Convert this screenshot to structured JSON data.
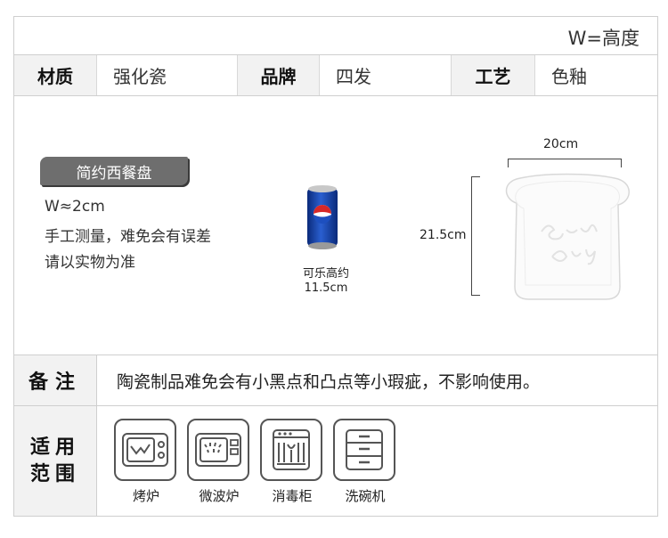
{
  "header": {
    "legend": "W=高度"
  },
  "specs": [
    {
      "key": "材质",
      "value": "强化瓷"
    },
    {
      "key": "品牌",
      "value": "四发"
    },
    {
      "key": "工艺",
      "value": "色釉"
    }
  ],
  "product": {
    "name": "简约西餐盘",
    "notes": [
      "W≈2cm",
      "手工测量，难免会有误差",
      "请以实物为准"
    ],
    "can_caption": [
      "可乐高约",
      "11.5cm"
    ],
    "width": "20cm",
    "height": "21.5cm"
  },
  "remark": {
    "label": "备注",
    "text": "陶瓷制品难免会有小黑点和凸点等小瑕疵，不影响使用。"
  },
  "usage": {
    "label_line1": "适用",
    "label_line2": "范围",
    "items": [
      {
        "icon": "oven-icon",
        "label": "烤炉"
      },
      {
        "icon": "microwave-icon",
        "label": "微波炉"
      },
      {
        "icon": "sterilizer-cabinet-icon",
        "label": "消毒柜"
      },
      {
        "icon": "dishwasher-icon",
        "label": "洗碗机"
      }
    ]
  }
}
